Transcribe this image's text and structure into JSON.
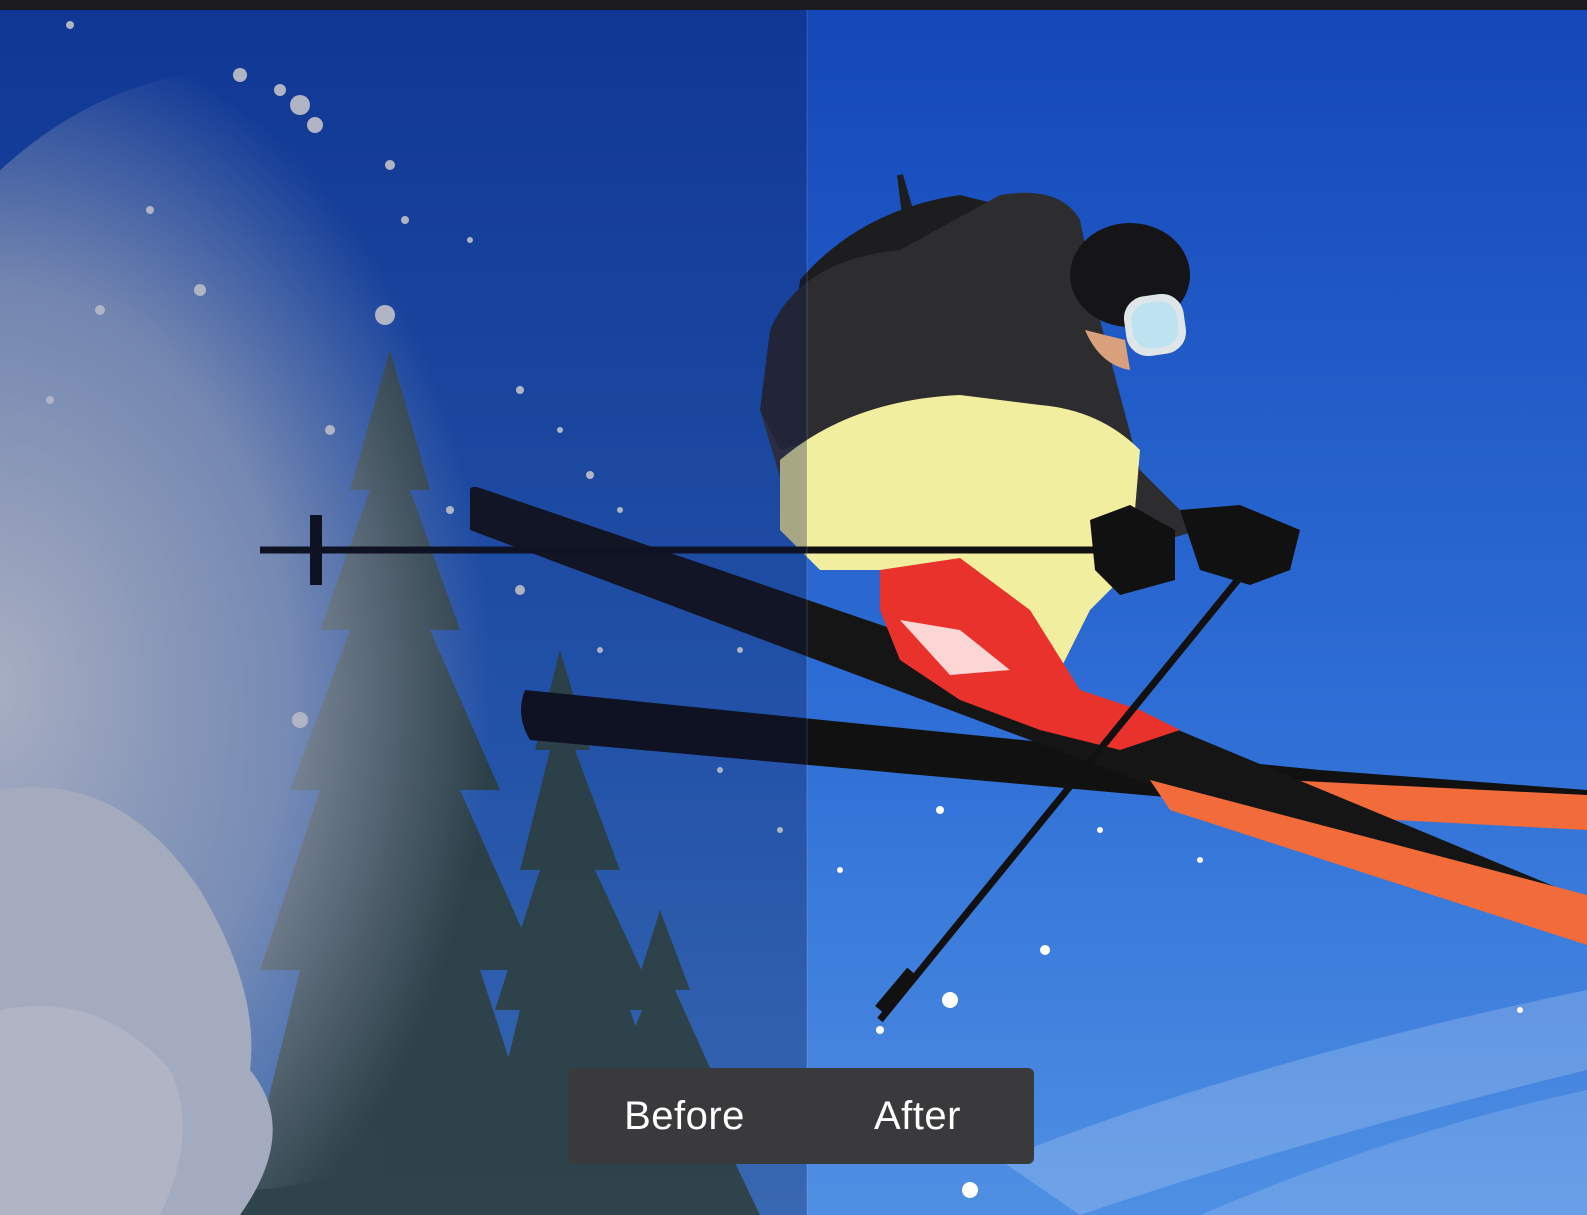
{
  "comparison": {
    "before_label": "Before",
    "after_label": "After",
    "active": "after"
  },
  "photo": {
    "subject": "skier-jumping",
    "colors": {
      "sky_top": "#1447b8",
      "sky_bottom": "#4f8fe3",
      "jacket": "#2d2d30",
      "pants": "#f2eea0",
      "boots": "#e8322b",
      "ski_tips": "#f26b3a",
      "ski_base": "#111111",
      "snow": "#f4f6fa",
      "trees": "#4a5a3a"
    }
  }
}
